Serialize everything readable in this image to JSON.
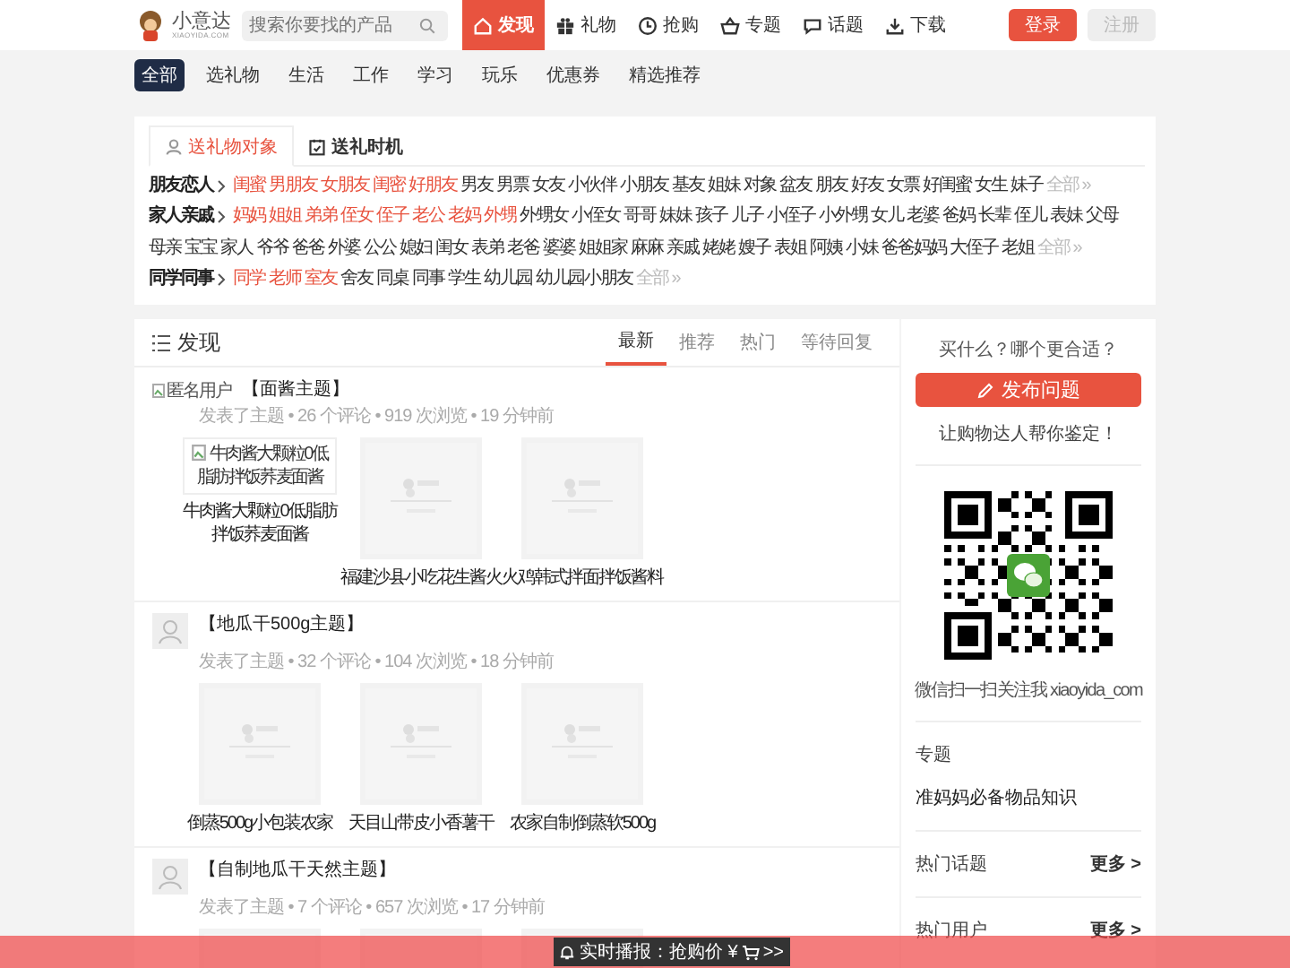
{
  "header": {
    "logo": {
      "name": "小意达",
      "domain": "XIAOYIDA.COM"
    },
    "search": {
      "placeholder": "搜索你要找的产品"
    },
    "nav": [
      {
        "label": "发现",
        "selected": true
      },
      {
        "label": "礼物",
        "selected": false
      },
      {
        "label": "抢购",
        "selected": false
      },
      {
        "label": "专题",
        "selected": false
      },
      {
        "label": "话题",
        "selected": false
      },
      {
        "label": "下载",
        "selected": false
      }
    ],
    "buttons": [
      {
        "label": "登录",
        "kind": "primary"
      },
      {
        "label": "注册",
        "kind": "secondary"
      }
    ]
  },
  "categories": [
    {
      "label": "全部",
      "selected": true
    },
    {
      "label": "选礼物",
      "selected": false
    },
    {
      "label": "生活",
      "selected": false
    },
    {
      "label": "工作",
      "selected": false
    },
    {
      "label": "学习",
      "selected": false
    },
    {
      "label": "玩乐",
      "selected": false
    },
    {
      "label": "优惠券",
      "selected": false
    },
    {
      "label": "精选推荐",
      "selected": false
    }
  ],
  "gift_tags": {
    "tabs": [
      {
        "label": "送礼物对象",
        "selected": true
      },
      {
        "label": "送礼时机",
        "selected": false
      }
    ],
    "groups": [
      {
        "label": "朋友恋人",
        "hot": [
          "闺蜜",
          "男朋友",
          "女朋友",
          "闺密",
          "好朋友"
        ],
        "tags": [
          "男友",
          "男票",
          "女友",
          "小伙伴",
          "小朋友",
          "基友",
          "姐妹",
          "对象",
          "盆友",
          "朋友",
          "好友",
          "女票",
          "好闺蜜",
          "女生",
          "妹子"
        ],
        "more": "全部 »"
      },
      {
        "label": "家人亲戚",
        "hot": [
          "妈妈",
          "姐姐",
          "弟弟",
          "侄女",
          "侄子",
          "老公",
          "老妈",
          "外甥"
        ],
        "tags": [
          "外甥女",
          "小侄女",
          "哥哥",
          "妹妹",
          "孩子",
          "儿子",
          "小侄子",
          "小外甥",
          "女儿",
          "老婆",
          "爸妈",
          "长辈",
          "侄儿",
          "表妹",
          "父母",
          "母亲",
          "宝宝",
          "家人",
          "爷爷",
          "爸爸",
          "外婆",
          "公公",
          "媳妇",
          "闺女",
          "表弟",
          "老爸",
          "婆婆",
          "姐姐家",
          "麻麻",
          "亲戚",
          "姥姥",
          "嫂子",
          "表姐",
          "阿姨",
          "小妹",
          "爸爸妈妈",
          "大侄子",
          "老姐"
        ],
        "more": "全部 »"
      },
      {
        "label": "同学同事",
        "hot": [
          "同学",
          "老师",
          "室友"
        ],
        "tags": [
          "舍友",
          "同桌",
          "同事",
          "学生",
          "幼儿园",
          "幼儿园小朋友"
        ],
        "more": "全部 »"
      }
    ]
  },
  "feed": {
    "title": "发现",
    "tabs": [
      {
        "label": "最新",
        "selected": true
      },
      {
        "label": "推荐",
        "selected": false
      },
      {
        "label": "热门",
        "selected": false
      },
      {
        "label": "等待回复",
        "selected": false
      }
    ],
    "posts": [
      {
        "avatar": {
          "kind": "broken",
          "alt": "匿名用户"
        },
        "title": "【面酱主题】",
        "meta": "发表了主题 • 26 个评论 • 919 次浏览 • 19 分钟前",
        "products": [
          {
            "kind": "broken",
            "alt": "牛肉酱大颗粒0低脂肪拌饭荞麦面酱",
            "caption": "牛肉酱大颗粒0低脂肪拌饭荞麦面酱"
          },
          {
            "kind": "picture",
            "caption": "福建沙县小吃花生酱火"
          },
          {
            "kind": "picture",
            "caption": "火鸡韩式拌面拌饭酱料"
          }
        ]
      },
      {
        "avatar": {
          "kind": "default"
        },
        "title": "【地瓜干500g主题】",
        "meta": "发表了主题 • 32 个评论 • 104 次浏览 • 18 分钟前",
        "products": [
          {
            "kind": "picture",
            "caption": "倒蒸500g小包装农家"
          },
          {
            "kind": "picture",
            "caption": "天目山带皮小香薯干"
          },
          {
            "kind": "picture",
            "caption": "农家自制倒蒸软500g"
          }
        ]
      },
      {
        "avatar": {
          "kind": "default"
        },
        "title": "【自制地瓜干天然主题】",
        "meta": "发表了主题 • 7 个评论 • 657 次浏览 • 17 分钟前"
      }
    ]
  },
  "sidebar": {
    "prompt": "买什么？哪个更合适？",
    "ask_button": "发布问题",
    "ask_hint": "让购物达人帮你鉴定！",
    "qr_caption": "微信扫一扫关注我 xiaoyida_com",
    "sections": [
      {
        "title": "专题",
        "items": [
          "准妈妈必备物品知识"
        ]
      },
      {
        "title": "热门话题",
        "more": "更多 >"
      },
      {
        "title": "热门用户",
        "more": "更多 >"
      }
    ]
  },
  "ticker": {
    "text": "实时播报：抢购价 ¥",
    "suffix": ">>"
  }
}
